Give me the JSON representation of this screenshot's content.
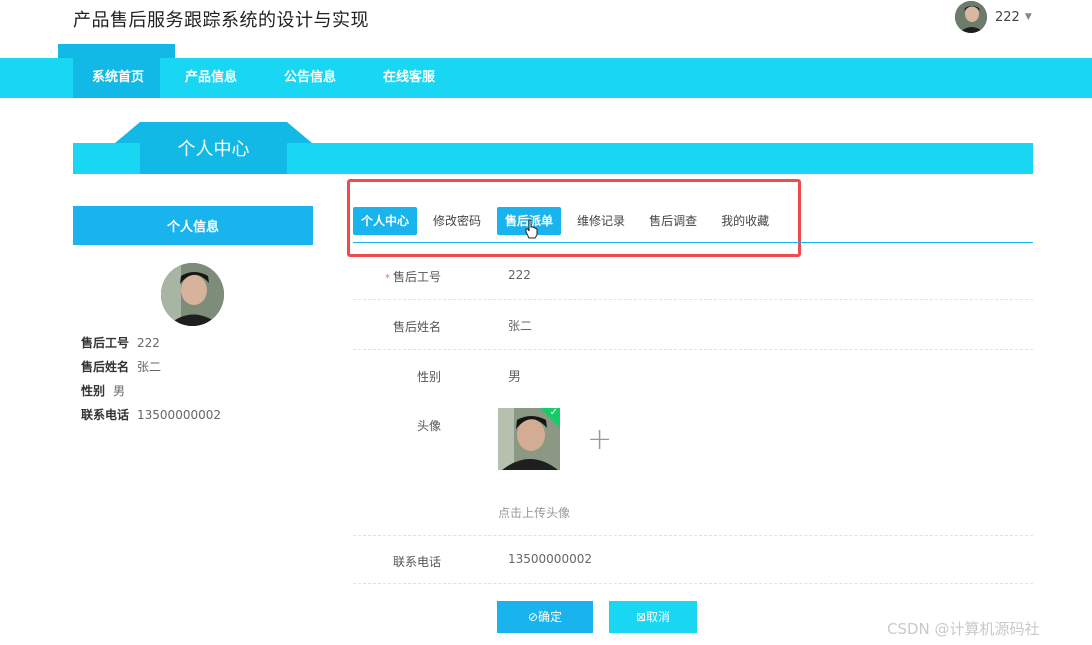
{
  "app": {
    "title": "产品售后服务跟踪系统的设计与实现"
  },
  "user": {
    "name": "222"
  },
  "nav": {
    "items": [
      "系统首页",
      "产品信息",
      "公告信息",
      "在线客服"
    ]
  },
  "banner": {
    "title": "个人中心"
  },
  "sidebar": {
    "head": "个人信息",
    "rows": [
      {
        "label": "售后工号",
        "value": "222"
      },
      {
        "label": "售后姓名",
        "value": "张二"
      },
      {
        "label": "性别",
        "value": "男"
      },
      {
        "label": "联系电话",
        "value": "13500000002"
      }
    ]
  },
  "tabs": [
    "个人中心",
    "修改密码",
    "售后派单",
    "维修记录",
    "售后调查",
    "我的收藏"
  ],
  "form": {
    "employee_no_label": "售后工号",
    "employee_no": "222",
    "name_label": "售后姓名",
    "name": "张二",
    "gender_label": "性别",
    "gender": "男",
    "avatar_label": "头像",
    "upload_hint": "点击上传头像",
    "phone_label": "联系电话",
    "phone": "13500000002"
  },
  "buttons": {
    "ok": "⊘确定",
    "cancel": "⊠取消"
  },
  "watermark": "CSDN @计算机源码社",
  "colors": {
    "nav": "#19d6f3",
    "accent": "#19b4ee",
    "highlight_box": "#f24a4a"
  }
}
